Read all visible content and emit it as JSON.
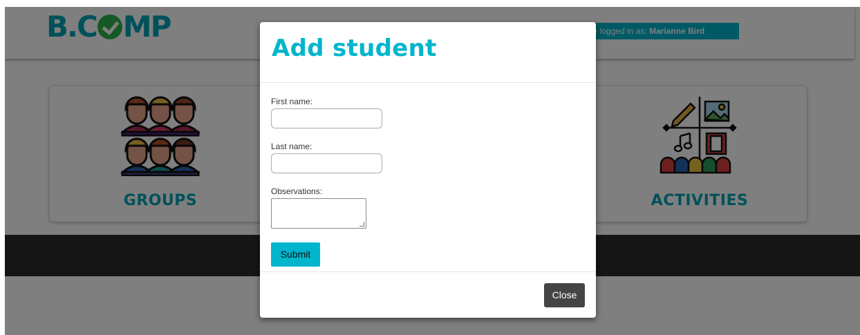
{
  "header": {
    "logo_text_left": "B.C",
    "logo_text_right": "MP",
    "login_prefix": "u are logged in as: ",
    "login_user": "Marianne Bird"
  },
  "cards": {
    "groups_label": "GROUPS",
    "activities_label": "ACTIVITIES"
  },
  "modal": {
    "title": "Add student",
    "first_name_label": "First name:",
    "first_name_value": "",
    "last_name_label": "Last name:",
    "last_name_value": "",
    "observations_label": "Observations:",
    "observations_value": "",
    "submit_label": "Submit",
    "close_label": "Close"
  },
  "colors": {
    "brand_teal": "#00b5cc",
    "logo_green": "#2db34a",
    "footer_dark": "#2b2b2b",
    "close_button": "#444444"
  },
  "icons": [
    "check-icon",
    "groups-icon",
    "activities-icon",
    "resize-grip-icon"
  ]
}
